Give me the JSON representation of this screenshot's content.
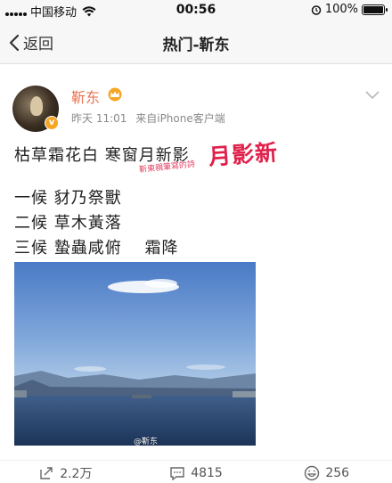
{
  "status_bar": {
    "carrier": "中国移动",
    "time": "00:56",
    "battery": "100%",
    "icons": [
      "signal-icon",
      "wifi-icon",
      "alarm-icon",
      "battery-icon"
    ]
  },
  "navbar": {
    "back_label": "返回",
    "title": "热门-靳东"
  },
  "post": {
    "username": "靳东",
    "badge": "v",
    "meta": {
      "time": "昨天 11:01",
      "source": "来自iPhone客户端"
    },
    "lines": [
      "枯草霜花白 寒窗月新影",
      "一候 豺乃祭獸",
      "二候 草木黃落",
      "三候 蟄蟲咸俯　 霜降"
    ],
    "handwriting_main": "月影新",
    "handwriting_small": "靳東親筆寫的詩",
    "photo_watermark": "@靳东"
  },
  "actions": {
    "repost_count": "2.2万",
    "comment_count": "4815",
    "like_count": "256"
  },
  "colors": {
    "username": "#eb7350",
    "handwriting": "#e0204a",
    "badge": "#f5a623"
  }
}
